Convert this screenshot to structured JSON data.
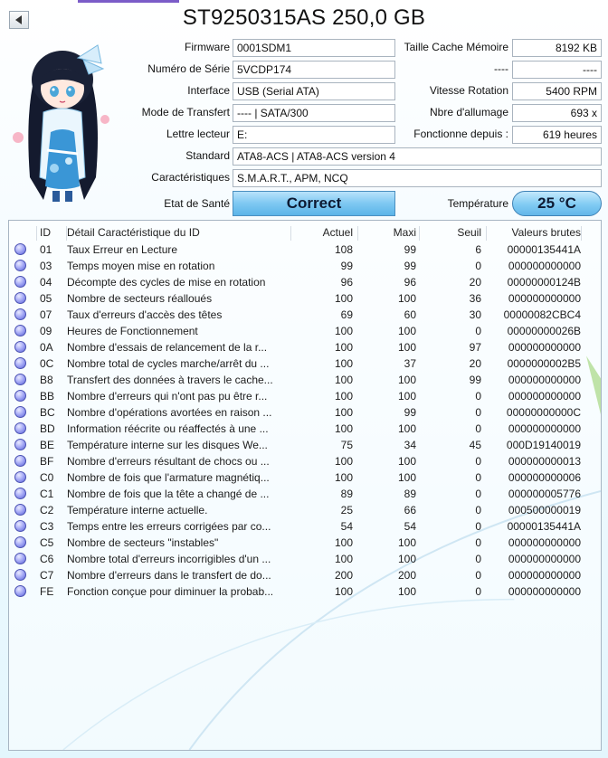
{
  "window": {
    "title": "ST9250315AS 250,0 GB"
  },
  "info": {
    "firmware_label": "Firmware",
    "firmware": "0001SDM1",
    "serial_label": "Numéro de Série",
    "serial": "5VCDP174",
    "interface_label": "Interface",
    "interface": "USB (Serial ATA)",
    "transfer_label": "Mode de Transfert",
    "transfer": "---- | SATA/300",
    "drive_label": "Lettre lecteur",
    "drive": "E:",
    "standard_label": "Standard",
    "standard": "ATA8-ACS | ATA8-ACS version 4",
    "features_label": "Caractéristiques",
    "features": "S.M.A.R.T., APM, NCQ",
    "cache_label": "Taille Cache Mémoire",
    "cache": "8192 KB",
    "blank_label": "----",
    "blank_value": "----",
    "rotation_label": "Vitesse Rotation",
    "rotation": "5400 RPM",
    "power_count_label": "Nbre d'allumage",
    "power_count": "693 x",
    "power_hours_label": "Fonctionne depuis :",
    "power_hours": "619 heures",
    "health_label": "Etat de Santé",
    "health": "Correct",
    "temperature_label": "Température",
    "temperature": "25 °C"
  },
  "table": {
    "headers": {
      "id": "ID",
      "name": "Détail Caractéristique du ID",
      "current": "Actuel",
      "worst": "Maxi",
      "threshold": "Seuil",
      "raw": "Valeurs brutes"
    },
    "rows": [
      {
        "id": "01",
        "name": "Taux Erreur en Lecture",
        "current": "108",
        "worst": "99",
        "threshold": "6",
        "raw": "00000135441A"
      },
      {
        "id": "03",
        "name": "Temps moyen mise en rotation",
        "current": "99",
        "worst": "99",
        "threshold": "0",
        "raw": "000000000000"
      },
      {
        "id": "04",
        "name": "Décompte des cycles de mise en rotation",
        "current": "96",
        "worst": "96",
        "threshold": "20",
        "raw": "00000000124B"
      },
      {
        "id": "05",
        "name": "Nombre de secteurs réalloués",
        "current": "100",
        "worst": "100",
        "threshold": "36",
        "raw": "000000000000"
      },
      {
        "id": "07",
        "name": "Taux d'erreurs d'accès des têtes",
        "current": "69",
        "worst": "60",
        "threshold": "30",
        "raw": "00000082CBC4"
      },
      {
        "id": "09",
        "name": "Heures de Fonctionnement",
        "current": "100",
        "worst": "100",
        "threshold": "0",
        "raw": "00000000026B"
      },
      {
        "id": "0A",
        "name": "Nombre d'essais de relancement de la r...",
        "current": "100",
        "worst": "100",
        "threshold": "97",
        "raw": "000000000000"
      },
      {
        "id": "0C",
        "name": "Nombre total de cycles marche/arrêt du ...",
        "current": "100",
        "worst": "37",
        "threshold": "20",
        "raw": "0000000002B5"
      },
      {
        "id": "B8",
        "name": "Transfert des données à travers le cache...",
        "current": "100",
        "worst": "100",
        "threshold": "99",
        "raw": "000000000000"
      },
      {
        "id": "BB",
        "name": "Nombre d'erreurs qui n'ont pas pu être r...",
        "current": "100",
        "worst": "100",
        "threshold": "0",
        "raw": "000000000000"
      },
      {
        "id": "BC",
        "name": "Nombre d'opérations avortées en raison ...",
        "current": "100",
        "worst": "99",
        "threshold": "0",
        "raw": "00000000000C"
      },
      {
        "id": "BD",
        "name": "Information réécrite ou réaffectés à une ...",
        "current": "100",
        "worst": "100",
        "threshold": "0",
        "raw": "000000000000"
      },
      {
        "id": "BE",
        "name": "Température interne sur les disques We...",
        "current": "75",
        "worst": "34",
        "threshold": "45",
        "raw": "000D19140019"
      },
      {
        "id": "BF",
        "name": "Nombre d'erreurs résultant de chocs ou ...",
        "current": "100",
        "worst": "100",
        "threshold": "0",
        "raw": "000000000013"
      },
      {
        "id": "C0",
        "name": "Nombre de fois que l'armature magnétiq...",
        "current": "100",
        "worst": "100",
        "threshold": "0",
        "raw": "000000000006"
      },
      {
        "id": "C1",
        "name": "Nombre de fois que la tête a changé de ...",
        "current": "89",
        "worst": "89",
        "threshold": "0",
        "raw": "000000005776"
      },
      {
        "id": "C2",
        "name": "Température interne actuelle.",
        "current": "25",
        "worst": "66",
        "threshold": "0",
        "raw": "000500000019"
      },
      {
        "id": "C3",
        "name": "Temps entre les erreurs corrigées par co...",
        "current": "54",
        "worst": "54",
        "threshold": "0",
        "raw": "00000135441A"
      },
      {
        "id": "C5",
        "name": "Nombre de secteurs \"instables\"",
        "current": "100",
        "worst": "100",
        "threshold": "0",
        "raw": "000000000000"
      },
      {
        "id": "C6",
        "name": "Nombre total d'erreurs incorrigibles d'un ...",
        "current": "100",
        "worst": "100",
        "threshold": "0",
        "raw": "000000000000"
      },
      {
        "id": "C7",
        "name": "Nombre d'erreurs dans le transfert de do...",
        "current": "200",
        "worst": "200",
        "threshold": "0",
        "raw": "000000000000"
      },
      {
        "id": "FE",
        "name": "Fonction conçue pour diminuer la probab...",
        "current": "100",
        "worst": "100",
        "threshold": "0",
        "raw": "000000000000"
      }
    ]
  },
  "colors": {
    "accent": "#7b5cc8",
    "health_blue": "#7ec8f2",
    "status_dot": "#5961d8"
  }
}
